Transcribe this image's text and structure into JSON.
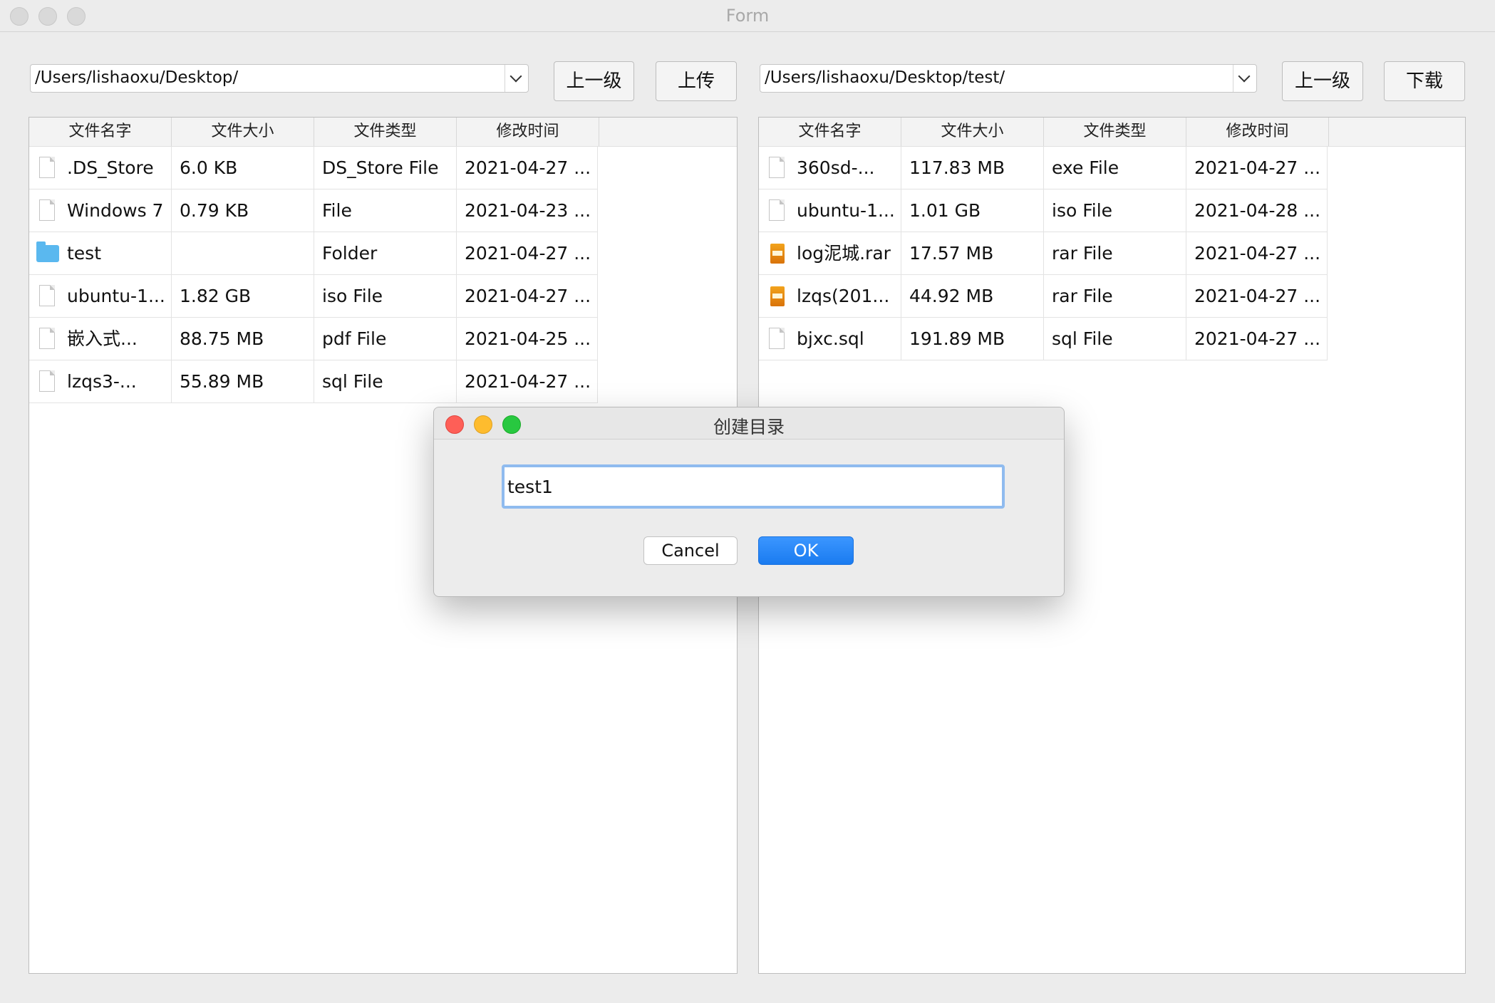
{
  "window": {
    "title": "Form"
  },
  "left": {
    "path": "/Users/lishaoxu/Desktop/",
    "up_label": "上一级",
    "action_label": "上传",
    "columns": [
      "文件名字",
      "文件大小",
      "文件类型",
      "修改时间"
    ],
    "rows": [
      {
        "icon": "document-icon",
        "name": ".DS_Store",
        "size": "6.0  KB",
        "type": "DS_Store File",
        "mtime": "2021-04-27 ..."
      },
      {
        "icon": "document-icon",
        "name": "Windows 7",
        "size": "0.79  KB",
        "type": "File",
        "mtime": "2021-04-23 ..."
      },
      {
        "icon": "folder-icon",
        "name": "test",
        "size": "",
        "type": "Folder",
        "mtime": "2021-04-27 ..."
      },
      {
        "icon": "document-icon",
        "name": "ubuntu-1...",
        "size": "1.82 GB",
        "type": "iso File",
        "mtime": "2021-04-27 ..."
      },
      {
        "icon": "document-icon",
        "name": "嵌入式...",
        "size": "88.75  MB",
        "type": "pdf File",
        "mtime": "2021-04-25 ..."
      },
      {
        "icon": "document-icon",
        "name": "lzqs3-...",
        "size": "55.89  MB",
        "type": "sql File",
        "mtime": "2021-04-27 ..."
      }
    ]
  },
  "right": {
    "path": "/Users/lishaoxu/Desktop/test/",
    "up_label": "上一级",
    "action_label": "下载",
    "columns": [
      "文件名字",
      "文件大小",
      "文件类型",
      "修改时间"
    ],
    "rows": [
      {
        "icon": "document-icon",
        "name": "360sd-...",
        "size": "117.83  MB",
        "type": "exe File",
        "mtime": "2021-04-27 ..."
      },
      {
        "icon": "document-icon",
        "name": "ubuntu-1...",
        "size": "1.01 GB",
        "type": "iso File",
        "mtime": "2021-04-28 ..."
      },
      {
        "icon": "archive-icon",
        "name": "log泥城.rar",
        "size": "17.57  MB",
        "type": "rar File",
        "mtime": "2021-04-27 ..."
      },
      {
        "icon": "archive-icon",
        "name": "lzqs(201...",
        "size": "44.92  MB",
        "type": "rar File",
        "mtime": "2021-04-27 ..."
      },
      {
        "icon": "document-icon",
        "name": "bjxc.sql",
        "size": "191.89  MB",
        "type": "sql File",
        "mtime": "2021-04-27 ..."
      }
    ]
  },
  "dialog": {
    "title": "创建目录",
    "input_value": "test1",
    "cancel_label": "Cancel",
    "ok_label": "OK"
  },
  "colors": {
    "accent": "#1a7bf0",
    "close": "#fe5f57",
    "minimize": "#febc2e",
    "maximize": "#28c840"
  }
}
